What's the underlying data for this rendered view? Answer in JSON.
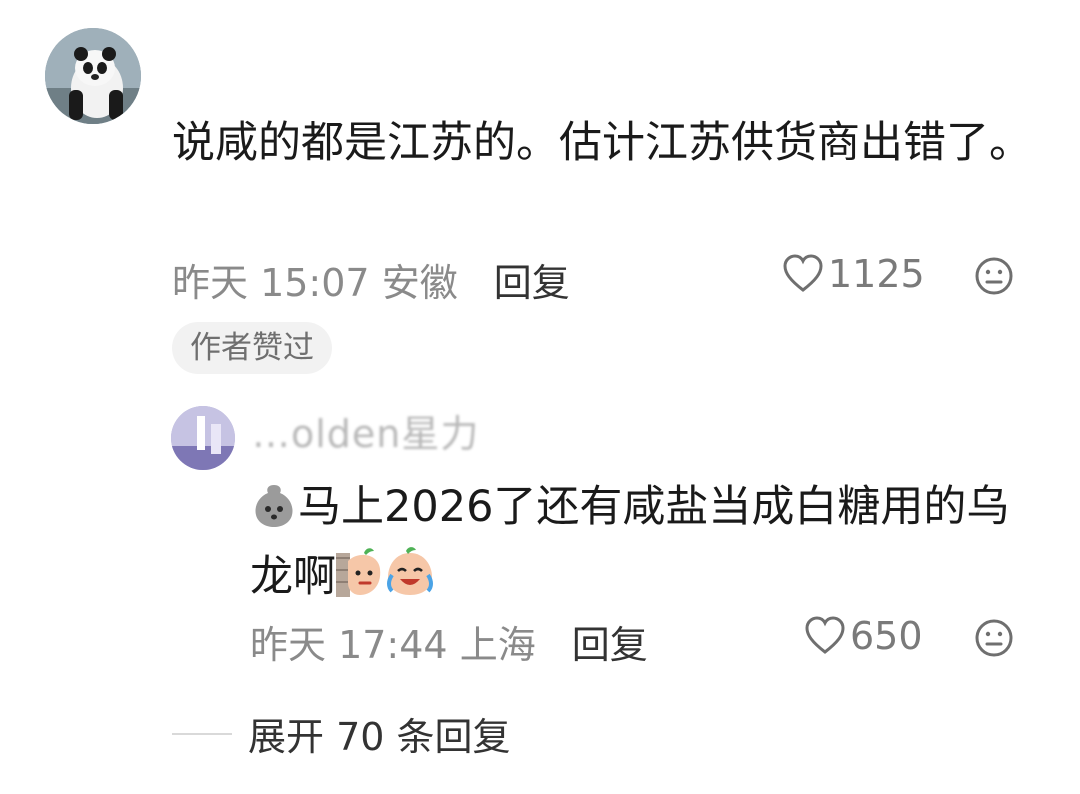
{
  "comment": {
    "text": "说咸的都是江苏的。估计江苏供货商出错了。",
    "time": "昨天 15:07",
    "location": "安徽",
    "reply_label": "回复",
    "likes": "1125",
    "badge": "作者赞过"
  },
  "reply": {
    "username": "…olden星力",
    "text": "马上2026了还有咸盐当成白糖用的乌龙啊",
    "time": "昨天 17:44",
    "location": "上海",
    "reply_label": "回复",
    "likes": "650"
  },
  "expand": {
    "label": "展开 70 条回复"
  },
  "icons": {
    "like": "heart-outline-icon",
    "more": "meh-face-icon",
    "emoji_inline": "bag-face-emoji",
    "emoji_trailing": [
      "peeking-sticker-emoji",
      "crying-laugh-sticker-emoji"
    ]
  }
}
